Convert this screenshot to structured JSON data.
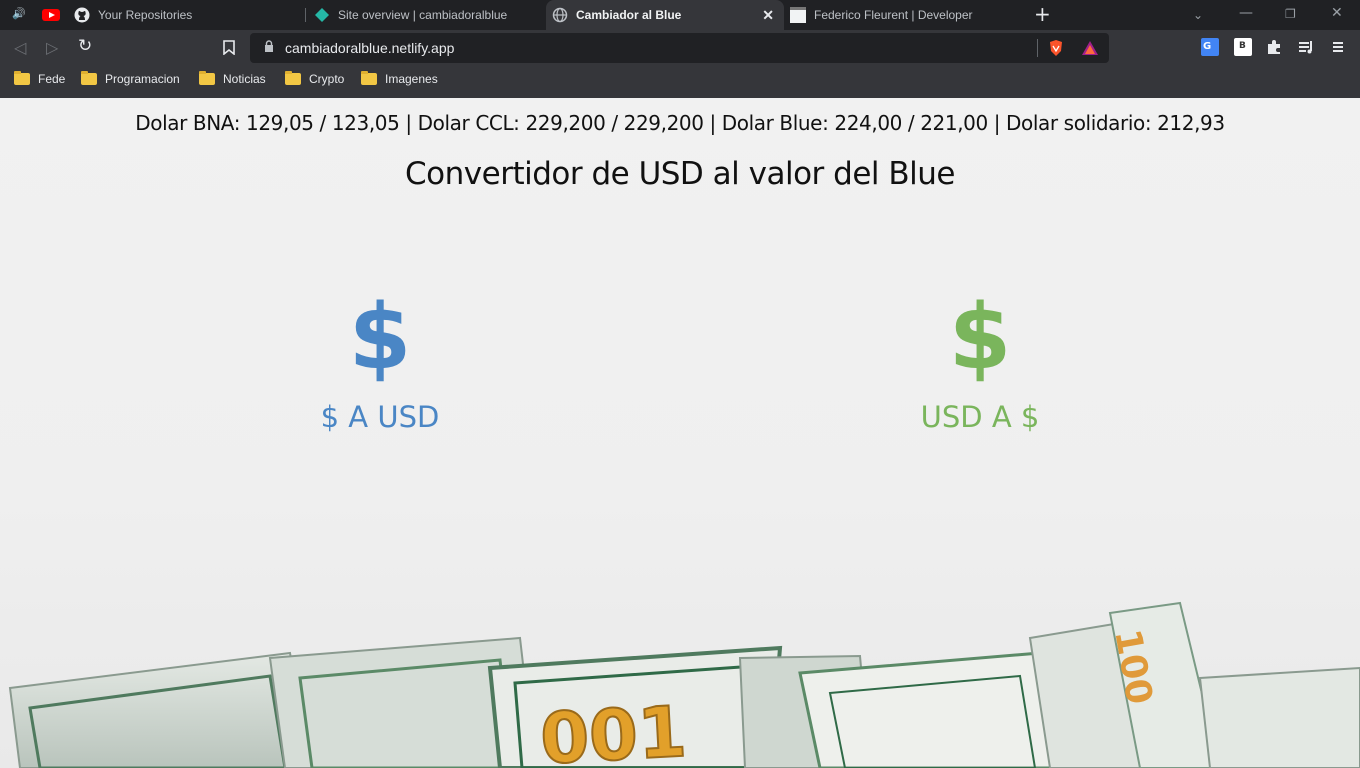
{
  "browser": {
    "tabs": [
      {
        "label": "Your Repositories",
        "icon": "github-icon"
      },
      {
        "label": "Site overview | cambiadoralblue",
        "icon": "netlify-icon"
      },
      {
        "label": "Cambiador al Blue",
        "icon": "globe-icon"
      },
      {
        "label": "Federico Fleurent | Developer",
        "icon": "page-icon"
      }
    ],
    "url": "cambiadoralblue.netlify.app",
    "bookmarks": [
      "Fede",
      "Programacion",
      "Noticias",
      "Crypto",
      "Imagenes"
    ]
  },
  "page": {
    "rates_text": "Dolar BNA: 129,05 / 123,05 | Dolar CCL: 229,200 / 229,200 | Dolar Blue: 224,00 / 221,00 | Dolar solidario: 212,93",
    "title": "Convertidor de USD al valor del Blue",
    "options": [
      {
        "symbol": "$",
        "label": "$ A USD",
        "color": "#4a86c5"
      },
      {
        "symbol": "$",
        "label": "USD A $",
        "color": "#7ab55c"
      }
    ]
  }
}
